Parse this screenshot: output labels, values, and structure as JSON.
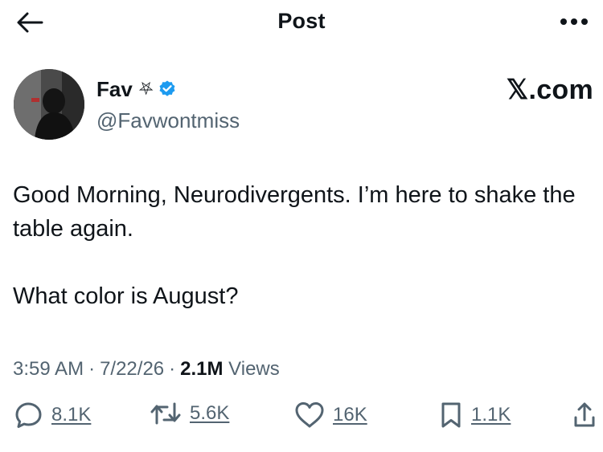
{
  "header": {
    "title": "Post",
    "back_icon": "arrow-left-icon",
    "more_icon": "more-dots-icon"
  },
  "author": {
    "name": "Fav",
    "name_symbol": "⛧",
    "verified": true,
    "verified_color": "#1d9bf0",
    "handle": "@Favwontmiss",
    "avatar_icon": "avatar-photo"
  },
  "watermark": "𝕏.com",
  "post": {
    "paragraph1": "Good Morning, Neurodivergents. I’m here to shake the table again.",
    "paragraph2": "What color is August?"
  },
  "meta": {
    "time": "3:59 AM",
    "sep1": "·",
    "date": "7/22/26",
    "sep2": "·",
    "views_count": "2.1M",
    "views_label": "Views"
  },
  "actions": {
    "replies": "8.1K",
    "reposts": "5.6K",
    "likes": "16K",
    "bookmarks": "1.1K"
  }
}
